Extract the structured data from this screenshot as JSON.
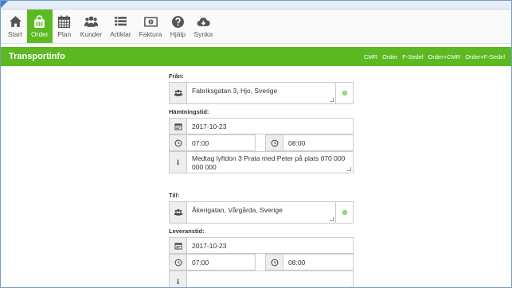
{
  "toolbar": {
    "items": [
      {
        "label": "Start",
        "icon": "home-icon"
      },
      {
        "label": "Order",
        "icon": "shopping-bag-icon"
      },
      {
        "label": "Plan",
        "icon": "calendar-grid-icon"
      },
      {
        "label": "Kunder",
        "icon": "users-icon"
      },
      {
        "label": "Artiklar",
        "icon": "list-icon"
      },
      {
        "label": "Faktura",
        "icon": "money-icon"
      },
      {
        "label": "Hjälp",
        "icon": "question-icon"
      },
      {
        "label": "Synka",
        "icon": "cloud-download-icon"
      }
    ],
    "active": "Order",
    "accent_color": "#5cb922"
  },
  "header": {
    "title": "Transportinfo",
    "links": [
      "CMR",
      "Order",
      "F-Sedel",
      "Order+CMR",
      "Order+F-Sedel"
    ]
  },
  "from": {
    "label": "Från:",
    "address": "Fabriksgatan 3, Hjo, Sverige",
    "pickup_label": "Hämtningstid:",
    "date": "2017-10-23",
    "time_from": "07:00",
    "time_to": "08:00",
    "note": "Medtag lyftdon 3 Prata med Peter på plats 070 000 000 000"
  },
  "to": {
    "label": "Till:",
    "address": "Åkerigatan, Vårgårda, Sverige",
    "delivery_label": "Leveranstid:",
    "date": "2017-10-23",
    "time_from": "07:00",
    "time_to": "08:00",
    "note": ""
  }
}
